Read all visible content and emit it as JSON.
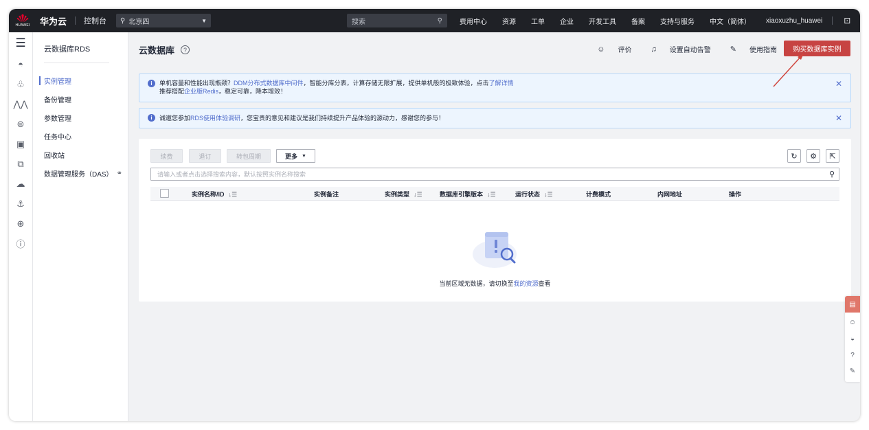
{
  "topbar": {
    "brand": "华为云",
    "logo_text": "HUAWEI",
    "console": "控制台",
    "region": "北京四",
    "search_placeholder": "搜索",
    "nav": [
      "费用中心",
      "资源",
      "工单",
      "企业",
      "开发工具",
      "备案",
      "支持与服务",
      "中文（简体）"
    ],
    "username": "xiaoxuzhu_huawei",
    "icons": [
      "terminal-icon",
      "mail-icon"
    ]
  },
  "rail_icons": [
    "menu-icon",
    "cloud-database-icon",
    "network-icon",
    "monitor-icon",
    "storage-icon",
    "document-icon",
    "copy-icon",
    "cloud-icon",
    "ship-icon",
    "globe-icon",
    "ip-icon"
  ],
  "submenu": {
    "title": "云数据库RDS",
    "items": [
      {
        "label": "实例管理",
        "active": true
      },
      {
        "label": "备份管理"
      },
      {
        "label": "参数管理"
      },
      {
        "label": "任务中心"
      },
      {
        "label": "回收站"
      },
      {
        "label": "数据管理服务（DAS）",
        "link_icon": "external-link-icon"
      }
    ]
  },
  "page": {
    "title": "云数据库",
    "tools": {
      "rate": "评价",
      "alarm": "设置自动告警",
      "guide": "使用指南"
    },
    "buy_button": "购买数据库实例"
  },
  "notice1": {
    "a": "单机容量和性能出现瓶颈？",
    "link1": "DDM分布式数据库中间件",
    "b": "，智能分库分表，计算存储无限扩展，提供单机般的极致体验，点击",
    "link2": "了解详情",
    "c": "推荐搭配",
    "link3": "企业版Redis",
    "d": "，稳定可靠，降本增效！"
  },
  "notice2": {
    "a": "诚邀您参加",
    "link1": "RDS使用体验调研",
    "b": "，您宝贵的意见和建议是我们持续提升产品体验的源动力，感谢您的参与！"
  },
  "toolbar": {
    "renew": "续费",
    "unsubscribe": "退订",
    "to_yearly": "转包周期",
    "more": "更多"
  },
  "search_box_placeholder": "请输入或者点击选择搜索内容，默认按照实例名称搜索",
  "table": {
    "columns": [
      "实例名称/ID",
      "实例备注",
      "实例类型",
      "数据库引擎版本",
      "运行状态",
      "计费模式",
      "内网地址",
      "操作"
    ],
    "rows": []
  },
  "empty": {
    "text": "当前区域无数据，请切换至",
    "link": "我的资源",
    "suffix": "查看"
  },
  "colors": {
    "accent": "#526ecc",
    "buy": "#c74342",
    "topbar": "#1f2126"
  }
}
